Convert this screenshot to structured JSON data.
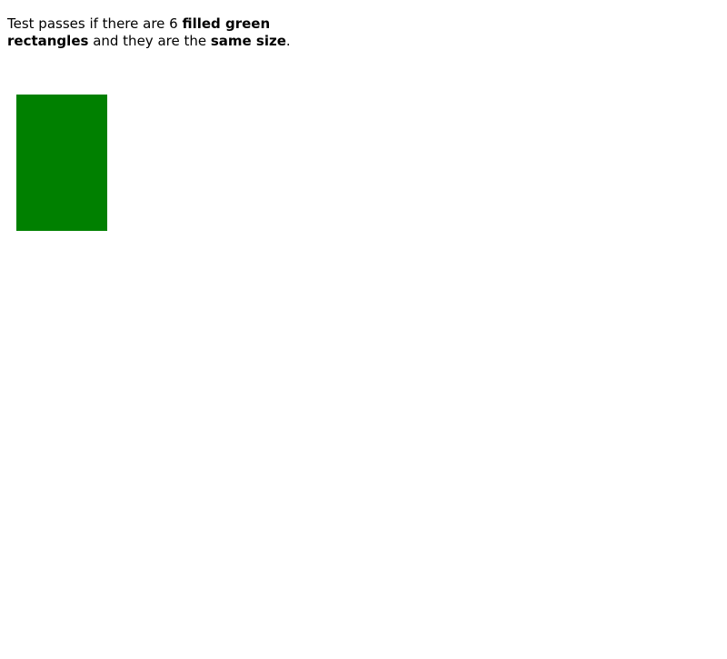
{
  "instructions": {
    "part1": "Test passes if there are 6 ",
    "emphasis1": "filled green rectangles",
    "part2": " and they are the ",
    "emphasis2": "same size",
    "part3": "."
  },
  "colors": {
    "rectangle_fill": "#008000",
    "background": "#ffffff",
    "text": "#000000"
  }
}
